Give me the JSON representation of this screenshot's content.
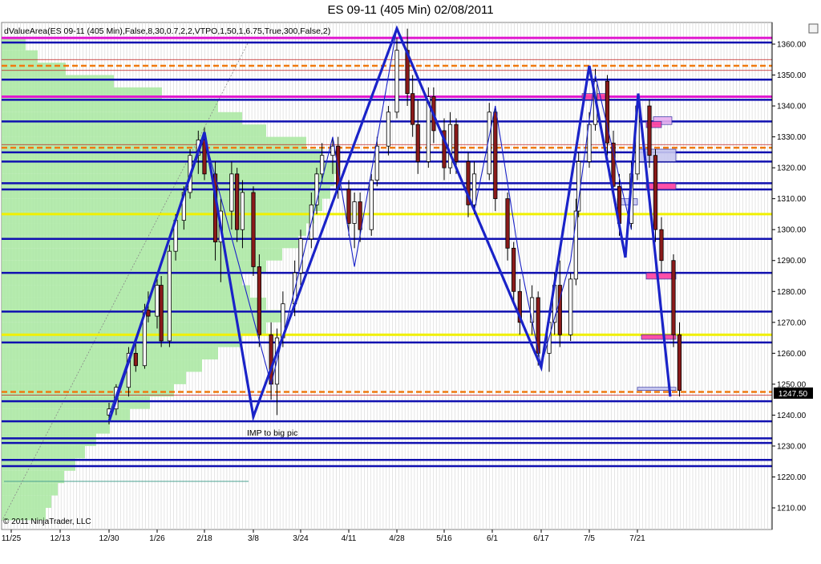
{
  "window": {
    "title": "ES 09-11 (405 Min)  02/08/2011"
  },
  "indicator_label": "dValueArea(ES 09-11 (405 Min),False,8,30,0.7,2,2,VTPO,1,50,1,6.75,True,300,False,2)",
  "copyright": "© 2011 NinjaTrader, LLC",
  "annotation": "IMP to big pic",
  "last_price_label": "1247.50",
  "colors": {
    "background": "#ffffff",
    "up_candle": "#ffffff",
    "down_candle": "#8b1a1a",
    "profile": "#a8e8a0",
    "blue_level": "#1010b0",
    "magenta_level": "#e01ad0",
    "yellow_level": "#f0f000",
    "orange_level": "#f07a10",
    "zigzag": "#1a23c8",
    "price_box": "#000000"
  },
  "chart_data": {
    "type": "candlestick",
    "title": "ES 09-11 (405 Min)  02/08/2011",
    "x_tick_labels": [
      "11/25",
      "12/13",
      "12/30",
      "1/26",
      "2/18",
      "3/8",
      "3/24",
      "4/11",
      "4/28",
      "5/16",
      "6/1",
      "6/17",
      "7/5",
      "7/21"
    ],
    "y_ticks": [
      1210,
      1220,
      1230,
      1240,
      1250,
      1260,
      1270,
      1280,
      1290,
      1300,
      1310,
      1320,
      1330,
      1340,
      1350,
      1360
    ],
    "y_tick_labels": [
      "1210.00",
      "1220.00",
      "1230.00",
      "1240.00",
      "1250.00",
      "1260.00",
      "1270.00",
      "1280.00",
      "1290.00",
      "1300.00",
      "1310.00",
      "1320.00",
      "1330.00",
      "1340.00",
      "1350.00",
      "1360.00"
    ],
    "ylim": [
      1203,
      1367
    ],
    "grid": "vertical",
    "last_price": 1247.5,
    "horizontal_levels": {
      "blue": [
        1360.5,
        1348.5,
        1342,
        1335,
        1325,
        1322,
        1315,
        1313,
        1297,
        1286,
        1273.5,
        1263.5,
        1244.5,
        1238,
        1232.5,
        1231,
        1225.5,
        1223.5
      ],
      "magenta": [
        1362,
        1343
      ],
      "yellow": [
        1305,
        1266
      ],
      "orange_dashed": [
        1353,
        1326.5,
        1247.5
      ],
      "red_thin": [
        1355,
        1351.5,
        1327.5,
        1246.5
      ]
    },
    "zigzag_thick": [
      {
        "x": "12/30",
        "y": 1238
      },
      {
        "x": "2/18",
        "y": 1331.5
      },
      {
        "x": "3/8",
        "y": 1239.5
      },
      {
        "x": "4/28",
        "y": 1365
      },
      {
        "x": "6/17",
        "y": 1255.5
      },
      {
        "x": "7/5",
        "y": 1353
      },
      {
        "x": "7/21",
        "y": 1291
      },
      {
        "x": "7/21",
        "y": 1344
      },
      {
        "x": "8/8",
        "y": 1246
      }
    ],
    "candles": [
      {
        "d": "12/30",
        "o": 1240,
        "h": 1244,
        "l": 1237,
        "c": 1242
      },
      {
        "d": "1/3",
        "o": 1242,
        "h": 1250,
        "l": 1240,
        "c": 1249
      },
      {
        "d": "1/10",
        "o": 1249,
        "h": 1262,
        "l": 1246,
        "c": 1260
      },
      {
        "d": "1/14",
        "o": 1260,
        "h": 1265,
        "l": 1254,
        "c": 1256
      },
      {
        "d": "1/19",
        "o": 1256,
        "h": 1276,
        "l": 1255,
        "c": 1274
      },
      {
        "d": "1/21",
        "o": 1274,
        "h": 1280,
        "l": 1270,
        "c": 1272
      },
      {
        "d": "1/26",
        "o": 1272,
        "h": 1284,
        "l": 1268,
        "c": 1282
      },
      {
        "d": "1/28",
        "o": 1282,
        "h": 1285,
        "l": 1262,
        "c": 1264
      },
      {
        "d": "2/1",
        "o": 1264,
        "h": 1295,
        "l": 1262,
        "c": 1293
      },
      {
        "d": "2/4",
        "o": 1293,
        "h": 1305,
        "l": 1290,
        "c": 1303
      },
      {
        "d": "2/8",
        "o": 1303,
        "h": 1314,
        "l": 1300,
        "c": 1312
      },
      {
        "d": "2/11",
        "o": 1312,
        "h": 1326,
        "l": 1310,
        "c": 1324
      },
      {
        "d": "2/15",
        "o": 1324,
        "h": 1332,
        "l": 1318,
        "c": 1329
      },
      {
        "d": "2/18",
        "o": 1329,
        "h": 1333,
        "l": 1316,
        "c": 1318
      },
      {
        "d": "2/22",
        "o": 1318,
        "h": 1322,
        "l": 1290,
        "c": 1296
      },
      {
        "d": "2/24",
        "o": 1296,
        "h": 1310,
        "l": 1283,
        "c": 1306
      },
      {
        "d": "2/28",
        "o": 1306,
        "h": 1322,
        "l": 1300,
        "c": 1318
      },
      {
        "d": "3/2",
        "o": 1318,
        "h": 1320,
        "l": 1296,
        "c": 1300
      },
      {
        "d": "3/4",
        "o": 1300,
        "h": 1316,
        "l": 1294,
        "c": 1312
      },
      {
        "d": "3/8",
        "o": 1312,
        "h": 1314,
        "l": 1285,
        "c": 1288
      },
      {
        "d": "3/10",
        "o": 1288,
        "h": 1292,
        "l": 1262,
        "c": 1266
      },
      {
        "d": "3/14",
        "o": 1266,
        "h": 1270,
        "l": 1245,
        "c": 1250
      },
      {
        "d": "3/16",
        "o": 1250,
        "h": 1268,
        "l": 1240,
        "c": 1265
      },
      {
        "d": "3/18",
        "o": 1265,
        "h": 1280,
        "l": 1262,
        "c": 1276
      },
      {
        "d": "3/22",
        "o": 1276,
        "h": 1290,
        "l": 1272,
        "c": 1286
      },
      {
        "d": "3/24",
        "o": 1286,
        "h": 1300,
        "l": 1282,
        "c": 1297
      },
      {
        "d": "3/28",
        "o": 1297,
        "h": 1312,
        "l": 1294,
        "c": 1308
      },
      {
        "d": "3/30",
        "o": 1308,
        "h": 1320,
        "l": 1305,
        "c": 1318
      },
      {
        "d": "4/1",
        "o": 1318,
        "h": 1328,
        "l": 1315,
        "c": 1324
      },
      {
        "d": "4/5",
        "o": 1324,
        "h": 1330,
        "l": 1318,
        "c": 1327
      },
      {
        "d": "4/7",
        "o": 1327,
        "h": 1330,
        "l": 1310,
        "c": 1313
      },
      {
        "d": "4/11",
        "o": 1313,
        "h": 1316,
        "l": 1298,
        "c": 1302
      },
      {
        "d": "4/13",
        "o": 1302,
        "h": 1312,
        "l": 1294,
        "c": 1309
      },
      {
        "d": "4/15",
        "o": 1309,
        "h": 1312,
        "l": 1296,
        "c": 1300
      },
      {
        "d": "4/19",
        "o": 1300,
        "h": 1318,
        "l": 1298,
        "c": 1316
      },
      {
        "d": "4/21",
        "o": 1316,
        "h": 1330,
        "l": 1314,
        "c": 1327
      },
      {
        "d": "4/25",
        "o": 1327,
        "h": 1340,
        "l": 1324,
        "c": 1338
      },
      {
        "d": "4/28",
        "o": 1338,
        "h": 1362,
        "l": 1336,
        "c": 1358
      },
      {
        "d": "5/2",
        "o": 1358,
        "h": 1365,
        "l": 1340,
        "c": 1344
      },
      {
        "d": "5/4",
        "o": 1344,
        "h": 1350,
        "l": 1330,
        "c": 1334
      },
      {
        "d": "5/6",
        "o": 1334,
        "h": 1342,
        "l": 1318,
        "c": 1322
      },
      {
        "d": "5/10",
        "o": 1322,
        "h": 1346,
        "l": 1320,
        "c": 1343
      },
      {
        "d": "5/12",
        "o": 1343,
        "h": 1346,
        "l": 1328,
        "c": 1332
      },
      {
        "d": "5/16",
        "o": 1332,
        "h": 1336,
        "l": 1316,
        "c": 1320
      },
      {
        "d": "5/18",
        "o": 1320,
        "h": 1338,
        "l": 1318,
        "c": 1334
      },
      {
        "d": "5/20",
        "o": 1334,
        "h": 1336,
        "l": 1318,
        "c": 1322
      },
      {
        "d": "5/24",
        "o": 1322,
        "h": 1325,
        "l": 1304,
        "c": 1308
      },
      {
        "d": "5/26",
        "o": 1308,
        "h": 1322,
        "l": 1305,
        "c": 1318
      },
      {
        "d": "5/31",
        "o": 1318,
        "h": 1341,
        "l": 1316,
        "c": 1338
      },
      {
        "d": "6/2",
        "o": 1338,
        "h": 1340,
        "l": 1306,
        "c": 1310
      },
      {
        "d": "6/6",
        "o": 1310,
        "h": 1312,
        "l": 1290,
        "c": 1294
      },
      {
        "d": "6/8",
        "o": 1294,
        "h": 1296,
        "l": 1276,
        "c": 1280
      },
      {
        "d": "6/10",
        "o": 1280,
        "h": 1284,
        "l": 1266,
        "c": 1270
      },
      {
        "d": "6/14",
        "o": 1270,
        "h": 1282,
        "l": 1266,
        "c": 1278
      },
      {
        "d": "6/16",
        "o": 1278,
        "h": 1280,
        "l": 1256,
        "c": 1260
      },
      {
        "d": "6/20",
        "o": 1260,
        "h": 1274,
        "l": 1254,
        "c": 1270
      },
      {
        "d": "6/22",
        "o": 1270,
        "h": 1286,
        "l": 1266,
        "c": 1282
      },
      {
        "d": "6/24",
        "o": 1282,
        "h": 1290,
        "l": 1262,
        "c": 1266
      },
      {
        "d": "6/28",
        "o": 1266,
        "h": 1286,
        "l": 1264,
        "c": 1284
      },
      {
        "d": "6/30",
        "o": 1284,
        "h": 1310,
        "l": 1282,
        "c": 1306
      },
      {
        "d": "7/1",
        "o": 1306,
        "h": 1325,
        "l": 1304,
        "c": 1322
      },
      {
        "d": "7/5",
        "o": 1322,
        "h": 1338,
        "l": 1320,
        "c": 1334
      },
      {
        "d": "7/7",
        "o": 1334,
        "h": 1352,
        "l": 1332,
        "c": 1348
      },
      {
        "d": "7/11",
        "o": 1348,
        "h": 1350,
        "l": 1324,
        "c": 1328
      },
      {
        "d": "7/13",
        "o": 1328,
        "h": 1332,
        "l": 1310,
        "c": 1314
      },
      {
        "d": "7/15",
        "o": 1314,
        "h": 1318,
        "l": 1298,
        "c": 1302
      },
      {
        "d": "7/19",
        "o": 1302,
        "h": 1322,
        "l": 1300,
        "c": 1318
      },
      {
        "d": "7/21",
        "o": 1318,
        "h": 1344,
        "l": 1316,
        "c": 1340
      },
      {
        "d": "7/25",
        "o": 1340,
        "h": 1342,
        "l": 1320,
        "c": 1324
      },
      {
        "d": "7/27",
        "o": 1324,
        "h": 1326,
        "l": 1296,
        "c": 1300
      },
      {
        "d": "7/29",
        "o": 1300,
        "h": 1304,
        "l": 1286,
        "c": 1290
      },
      {
        "d": "8/2",
        "o": 1290,
        "h": 1292,
        "l": 1262,
        "c": 1266
      },
      {
        "d": "8/4",
        "o": 1266,
        "h": 1270,
        "l": 1246,
        "c": 1248
      }
    ]
  }
}
